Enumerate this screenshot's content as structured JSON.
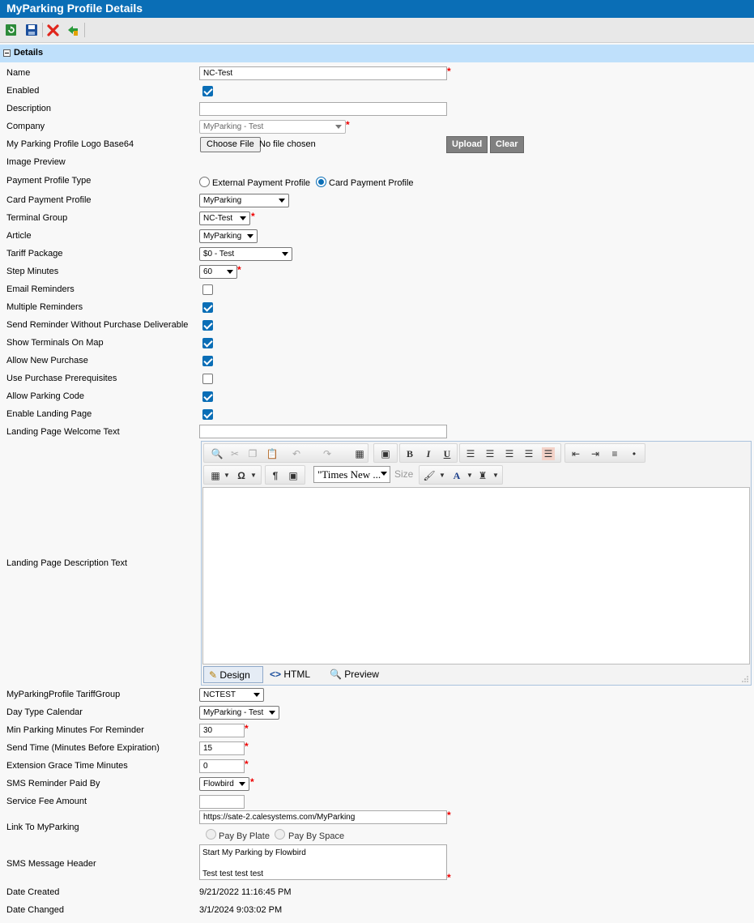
{
  "title": "MyParking Profile Details",
  "toolbar": {
    "icons": [
      "refresh-icon",
      "save-icon",
      "delete-icon",
      "back-icon"
    ]
  },
  "section": {
    "title": "Details"
  },
  "fields": {
    "name": {
      "label": "Name",
      "value": "NC-Test"
    },
    "enabled": {
      "label": "Enabled",
      "checked": true
    },
    "description": {
      "label": "Description",
      "value": ""
    },
    "company": {
      "label": "Company",
      "value": "MyParking - Test"
    },
    "logo": {
      "label": "My Parking Profile Logo Base64",
      "choose_label": "Choose File",
      "file_status": "No file chosen",
      "upload_label": "Upload",
      "clear_label": "Clear"
    },
    "image_preview": {
      "label": "Image Preview"
    },
    "payment_profile_type": {
      "label": "Payment Profile Type",
      "options": [
        "External Payment Profile",
        "Card Payment Profile"
      ],
      "selected": "Card Payment Profile"
    },
    "card_payment_profile": {
      "label": "Card Payment Profile",
      "value": "MyParking"
    },
    "terminal_group": {
      "label": "Terminal Group",
      "value": "NC-Test"
    },
    "article": {
      "label": "Article",
      "value": "MyParking"
    },
    "tariff_package": {
      "label": "Tariff Package",
      "value": "$0 - Test"
    },
    "step_minutes": {
      "label": "Step Minutes",
      "value": "60"
    },
    "email_reminders": {
      "label": "Email Reminders",
      "checked": false
    },
    "multiple_reminders": {
      "label": "Multiple Reminders",
      "checked": true
    },
    "send_reminder_without": {
      "label": "Send Reminder Without Purchase Deliverable",
      "checked": true
    },
    "show_terminals": {
      "label": "Show Terminals On Map",
      "checked": true
    },
    "allow_new_purchase": {
      "label": "Allow New Purchase",
      "checked": true
    },
    "use_prerequisites": {
      "label": "Use Purchase Prerequisites",
      "checked": false
    },
    "allow_parking_code": {
      "label": "Allow Parking Code",
      "checked": true
    },
    "enable_landing_page": {
      "label": "Enable Landing Page",
      "checked": true
    },
    "landing_welcome": {
      "label": "Landing Page Welcome Text",
      "value": ""
    },
    "landing_description": {
      "label": "Landing Page Description Text"
    },
    "tariff_group": {
      "label": "MyParkingProfile TariffGroup",
      "value": "NCTEST"
    },
    "day_type_calendar": {
      "label": "Day Type Calendar",
      "value": "MyParking - Test"
    },
    "min_parking_minutes": {
      "label": "Min Parking Minutes For Reminder",
      "value": "30"
    },
    "send_time": {
      "label": "Send Time (Minutes Before Expiration)",
      "value": "15"
    },
    "extension_grace": {
      "label": "Extension Grace Time Minutes",
      "value": "0"
    },
    "sms_paid_by": {
      "label": "SMS Reminder Paid By",
      "value": "Flowbird"
    },
    "service_fee": {
      "label": "Service Fee Amount",
      "value": ""
    },
    "link_to_myparking": {
      "label": "Link To MyParking",
      "value": "https://sate-2.calesystems.com/MyParking",
      "options": [
        "Pay By Plate",
        "Pay By Space"
      ]
    },
    "sms_header": {
      "label": "SMS Message Header",
      "value": "Start My Parking by Flowbird\n\nTest test test test"
    },
    "date_created": {
      "label": "Date Created",
      "value": "9/21/2022 11:16:45 PM"
    },
    "date_changed": {
      "label": "Date Changed",
      "value": "3/1/2024 9:03:02 PM"
    }
  },
  "editor": {
    "font_name": "\"Times New ...",
    "font_size_placeholder": "Size",
    "tabs": [
      "Design",
      "HTML",
      "Preview"
    ],
    "active_tab": "Design"
  }
}
